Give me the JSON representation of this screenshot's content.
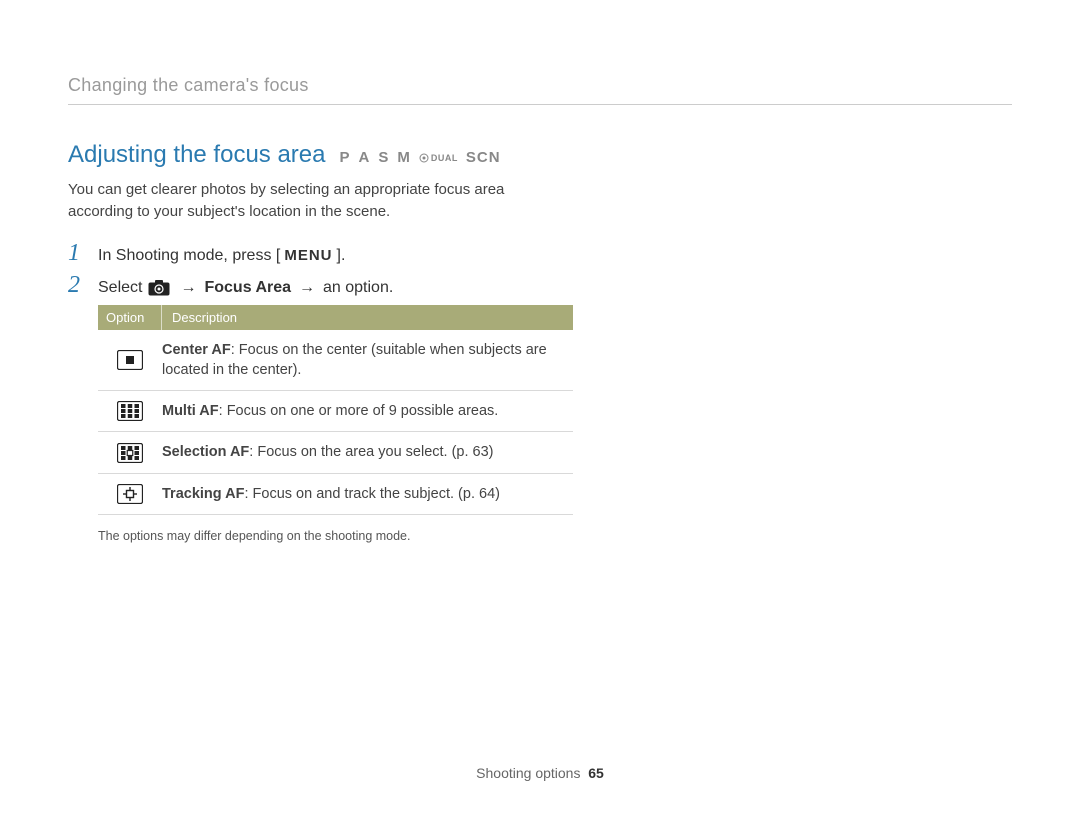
{
  "breadcrumb": "Changing the camera's focus",
  "heading": "Adjusting the focus area",
  "modes": {
    "p": "P",
    "a": "A",
    "s": "S",
    "m": "M",
    "dual": "DUAL",
    "scn": "SCN"
  },
  "intro": "You can get clearer photos by selecting an appropriate focus area according to your subject's location in the scene.",
  "steps": {
    "s1_pre": "In Shooting mode, press [",
    "s1_key": "MENU",
    "s1_post": "].",
    "s2_pre": "Select",
    "s2_arrow1": "→",
    "s2_bold": "Focus Area",
    "s2_arrow2": "→",
    "s2_post": "an option."
  },
  "table": {
    "header_option": "Option",
    "header_desc": "Description",
    "rows": [
      {
        "name": "Center AF",
        "desc": ": Focus on the center (suitable when subjects are located in the center)."
      },
      {
        "name": "Multi AF",
        "desc": ": Focus on one or more of 9 possible areas."
      },
      {
        "name": "Selection AF",
        "desc": ": Focus on the area you select. (p. 63)"
      },
      {
        "name": "Tracking AF",
        "desc": ": Focus on and track the subject. (p. 64)"
      }
    ],
    "note": "The options may differ depending on the shooting mode."
  },
  "footer": {
    "section": "Shooting options",
    "page": "65"
  }
}
